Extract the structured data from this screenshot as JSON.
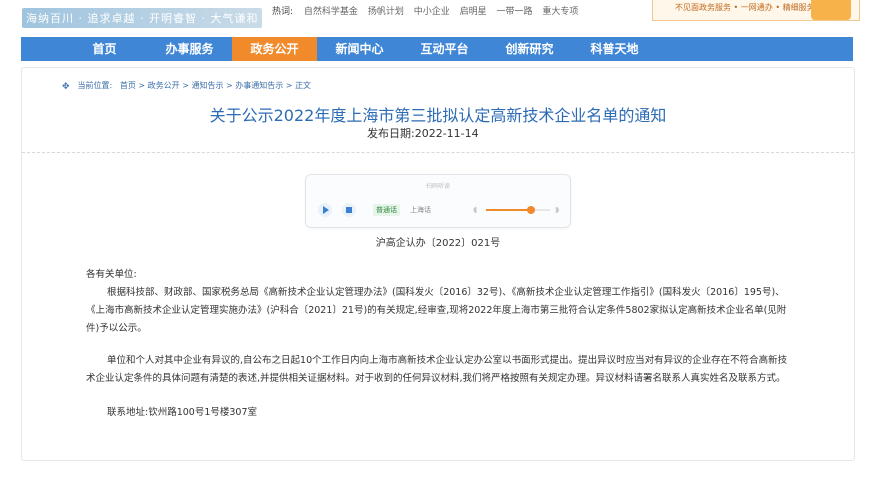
{
  "header": {
    "slogan": "海纳百川 · 追求卓越 · 开明睿智 · 大气谦和",
    "hot_label": "热词:",
    "hot_words": [
      "自然科学基金",
      "扬帆计划",
      "中小企业",
      "启明星",
      "一带一路",
      "重大专项"
    ],
    "promo_text": "不见面政务服务 • 一网通办 • 精细服务"
  },
  "nav": {
    "items": [
      "首页",
      "办事服务",
      "政务公开",
      "新闻中心",
      "互动平台",
      "创新研究",
      "科普天地"
    ],
    "active_index": 2
  },
  "breadcrumb": {
    "label": "当前位置:",
    "path": "首页 > 政务公开 > 通知告示 > 办事通知告示 > 正文"
  },
  "article": {
    "title": "关于公示2022年度上海市第三批拟认定高新技术企业名单的通知",
    "date": "发布日期:2022-11-14",
    "doc_number": "沪高企认办〔2022〕021号",
    "salutation": "各有关单位:",
    "paragraph1": "根据科技部、财政部、国家税务总局《高新技术企业认定管理办法》(国科发火〔2016〕32号)、《高新技术企业认定管理工作指引》(国科发火〔2016〕195号)、《上海市高新技术企业认定管理实施办法》(沪科合〔2021〕21号)的有关规定,经审查,现将2022年度上海市第三批符合认定条件5802家拟认定高新技术企业名单(见附件)予以公示。",
    "paragraph2": "单位和个人对其中企业有异议的,自公布之日起10个工作日内向上海市高新技术企业认定办公室以书面形式提出。提出异议时应当对有异议的企业存在不符合高新技术企业认定条件的具体问题有清楚的表述,并提供相关证据材料。对于收到的任何异议材料,我们将严格按照有关规定办理。异议材料请署名联系人真实姓名及联系方式。",
    "contact": "联系地址:钦州路100号1号楼307室"
  },
  "player": {
    "title": "扫码听读",
    "lang_primary": "普通话",
    "lang_secondary": "上海话",
    "volume": 0.7,
    "colors": {
      "accent": "#f08a2a",
      "primary": "#3a7fd0"
    }
  },
  "colors": {
    "nav_bg": "#3f86d6",
    "nav_active": "#f08a2a",
    "title": "#2c6bb5"
  }
}
